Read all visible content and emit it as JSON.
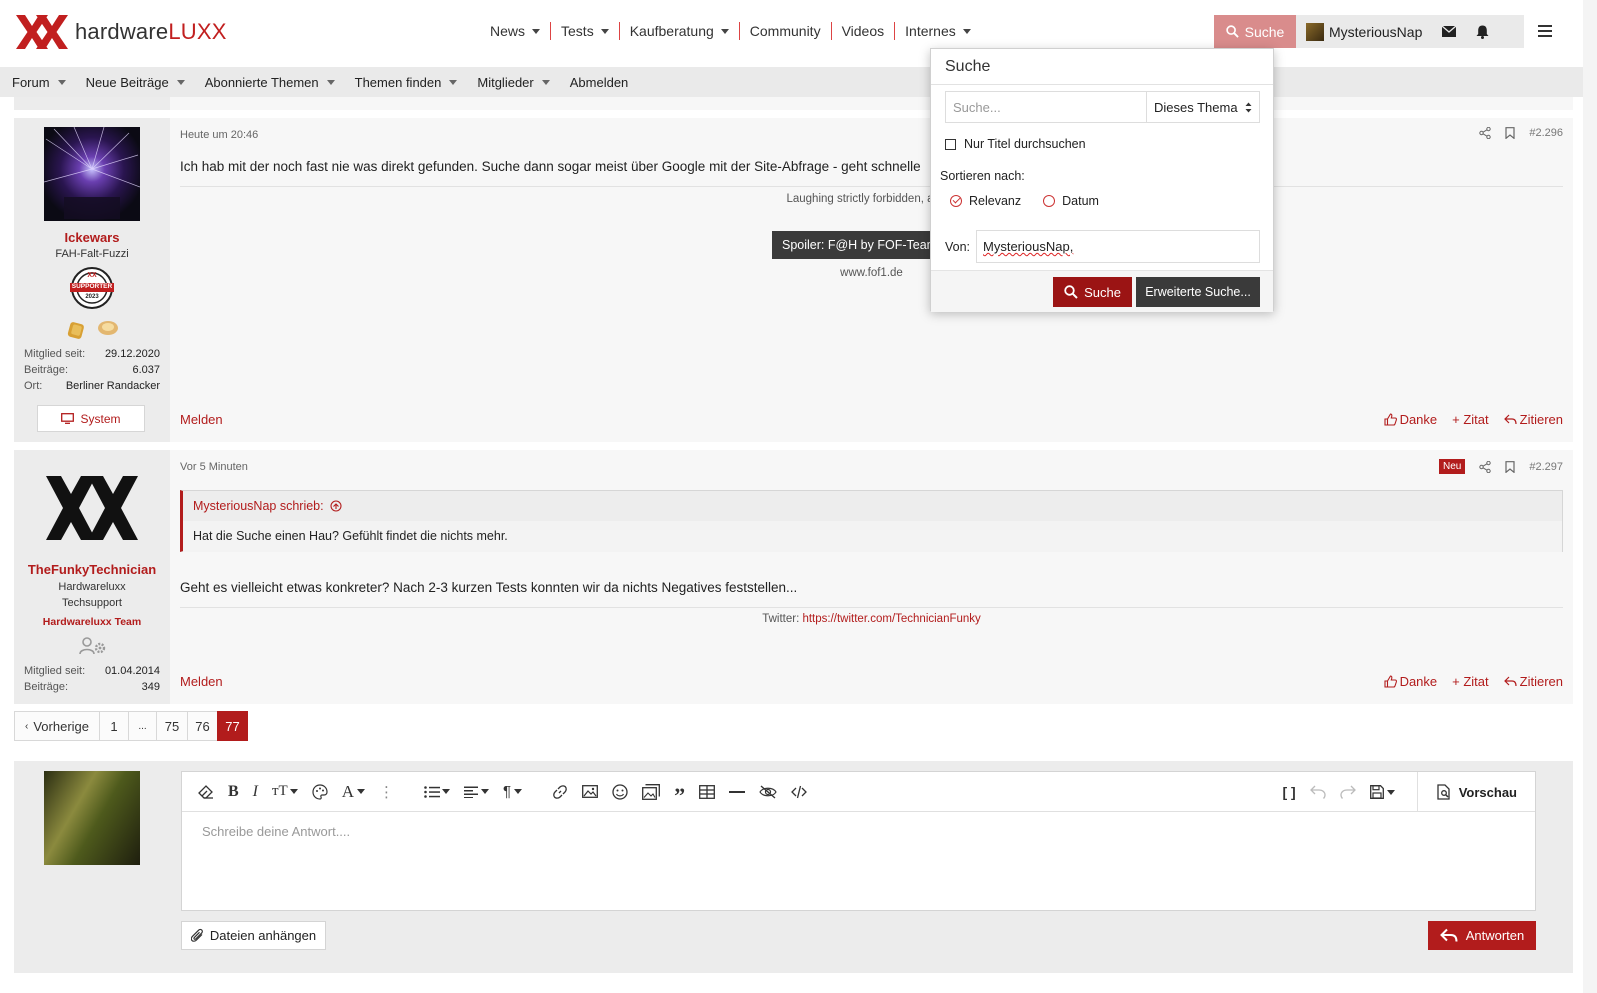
{
  "brand": {
    "name_pre": "hardware",
    "name_post": "LUXX"
  },
  "mainnav": {
    "news": "News",
    "tests": "Tests",
    "kaufberatung": "Kaufberatung",
    "community": "Community",
    "videos": "Videos",
    "internes": "Internes"
  },
  "userbar": {
    "search_label": "Suche",
    "username": "MysteriousNap"
  },
  "subnav": {
    "forum": "Forum",
    "neue": "Neue Beiträge",
    "abonnierte": "Abonnierte Themen",
    "finden": "Themen finden",
    "mitglieder": "Mitglieder",
    "abmelden": "Abmelden"
  },
  "post1": {
    "username": "Ickewars",
    "usertitle": "FAH-Falt-Fuzzi",
    "badge_top": "XX",
    "badge_mid": "SUPPORTER",
    "badge_year": "2023",
    "stat1_label": "Mitglied seit:",
    "stat1_value": "29.12.2020",
    "stat2_label": "Beiträge:",
    "stat2_value": "6.037",
    "stat3_label": "Ort:",
    "stat3_value": "Berliner Randacker",
    "system_label": "System",
    "date": "Heute um 20:46",
    "number": "#2.296",
    "text": "Ich hab mit der noch fast nie was direkt gefunden. Suche dann sogar meist über Google mit der Site-Abfrage - geht schnelle",
    "sig1": "Laughing strictly forbidden, alway",
    "spoiler": "Spoiler: F@H by FOF-Team",
    "sig_link": "www.fof1.de",
    "melden": "Melden",
    "danke": "Danke",
    "zitat": "+ Zitat",
    "zitieren": "Zitieren"
  },
  "post2": {
    "username": "TheFunkyTechnician",
    "usertitle1": "Hardwareluxx",
    "usertitle2": "Techsupport",
    "team": "Hardwareluxx Team",
    "stat1_label": "Mitglied seit:",
    "stat1_value": "01.04.2014",
    "stat2_label": "Beiträge:",
    "stat2_value": "349",
    "date": "Vor 5 Minuten",
    "new_badge": "Neu",
    "number": "#2.297",
    "quote_author": "MysteriousNap schrieb:",
    "quote_text": "Hat die Suche einen Hau? Gefühlt findet die nichts mehr.",
    "text": "Geht es vielleicht etwas konkreter? Nach 2-3 kurzen Tests konnten wir da nichts Negatives feststellen...",
    "sig_prefix": "Twitter:",
    "sig_link": "https://twitter.com/TechnicianFunky",
    "melden": "Melden",
    "danke": "Danke",
    "zitat": "+ Zitat",
    "zitieren": "Zitieren"
  },
  "pagination": {
    "prev": "Vorherige",
    "p1": "1",
    "dots": "...",
    "p75": "75",
    "p76": "76",
    "p77": "77"
  },
  "reply": {
    "placeholder": "Schreibe deine Antwort....",
    "vorschau": "Vorschau",
    "attach": "Dateien anhängen",
    "submit": "Antworten"
  },
  "search_popup": {
    "title": "Suche",
    "placeholder": "Suche...",
    "scope": "Dieses Thema",
    "titles_only": "Nur Titel durchsuchen",
    "sort_label": "Sortieren nach:",
    "sort_relevance": "Relevanz",
    "sort_date": "Datum",
    "from_label": "Von:",
    "from_value": "MysteriousNap,",
    "search_button": "Suche",
    "advanced_button": "Erweiterte Suche..."
  },
  "colors": {
    "accent": "#b21c1c",
    "suche_active": "#d98c8c"
  }
}
